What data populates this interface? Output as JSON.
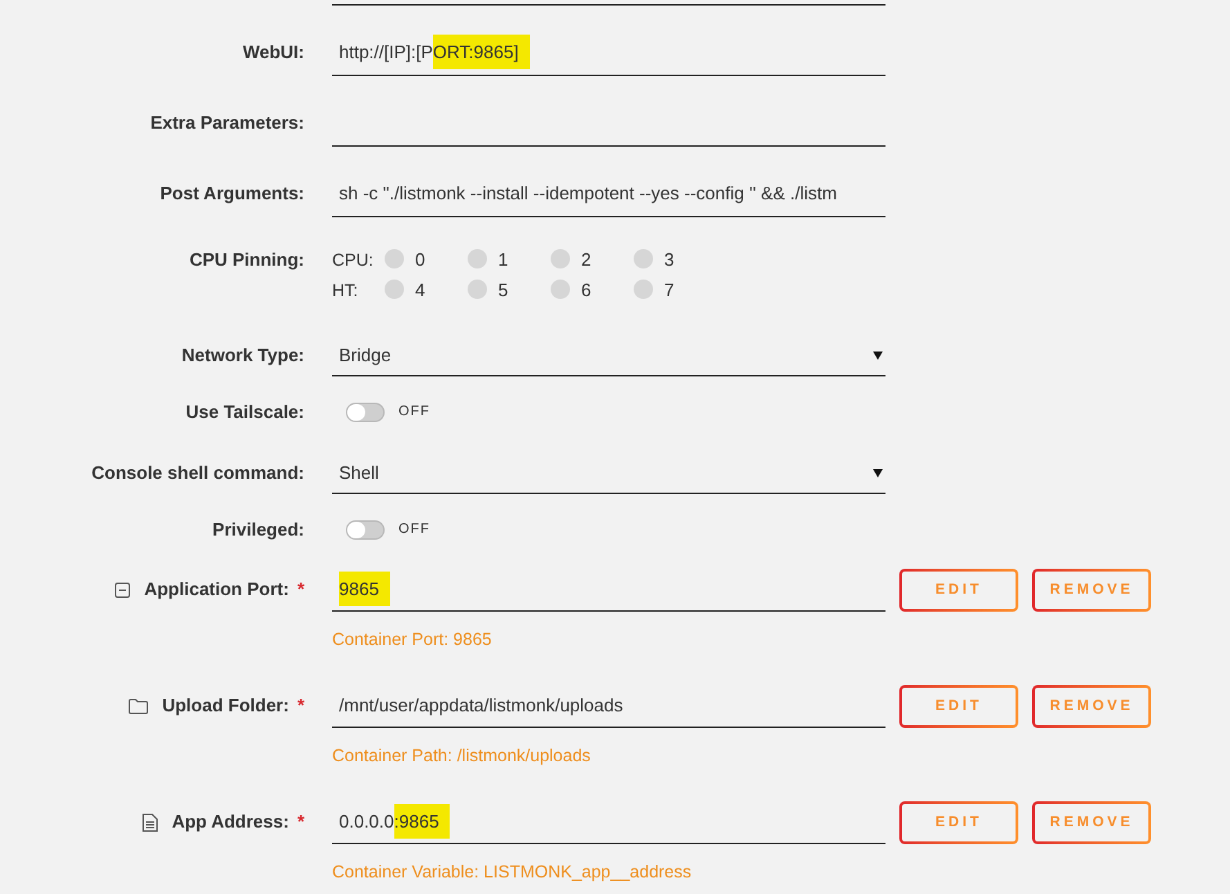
{
  "settings": [
    {
      "kind": "text",
      "label": "WebUI:",
      "value": [
        {
          "text": "http://[IP]:[P",
          "highlighted": false
        },
        {
          "text": "ORT:9865]",
          "highlighted": true
        }
      ]
    },
    {
      "kind": "text",
      "label": "Extra Parameters:"
    },
    {
      "kind": "text",
      "label": "Post Arguments:",
      "value": [
        {
          "text": "sh -c \"./listmonk --install --idempotent --yes --config '' && ./listm",
          "highlighted": false
        }
      ]
    },
    {
      "kind": "cpu_pinning",
      "label": "CPU Pinning:",
      "rows": [
        {
          "label": "CPU:",
          "cores": [
            {
              "number": "0",
              "checked": false
            },
            {
              "number": "1",
              "checked": false
            },
            {
              "number": "2",
              "checked": false
            },
            {
              "number": "3",
              "checked": false
            }
          ]
        },
        {
          "label": "HT:",
          "cores": [
            {
              "number": "4",
              "checked": false
            },
            {
              "number": "5",
              "checked": false
            },
            {
              "number": "6",
              "checked": false
            },
            {
              "number": "7",
              "checked": false
            }
          ]
        }
      ]
    },
    {
      "kind": "select",
      "label": "Network Type:",
      "value": "Bridge"
    },
    {
      "kind": "switch",
      "label": "Use Tailscale:",
      "on": false,
      "state_text": "OFF"
    },
    {
      "kind": "select",
      "label": "Console shell command:",
      "value": "Shell"
    },
    {
      "kind": "switch",
      "label": "Privileged:",
      "on": false,
      "state_text": "OFF"
    }
  ],
  "config_items": [
    {
      "kind": "port",
      "label": "Application Port:",
      "required_mark": "*",
      "value": [
        {
          "text": "9865",
          "highlighted": true
        }
      ],
      "description": "Container Port: 9865",
      "buttons": [
        "EDIT",
        "REMOVE"
      ]
    },
    {
      "kind": "path",
      "label": "Upload Folder:",
      "required_mark": "*",
      "value": [
        {
          "text": "/mnt/user/appdata/listmonk/uploads",
          "highlighted": false
        }
      ],
      "description": "Container Path: /listmonk/uploads",
      "buttons": [
        "EDIT",
        "REMOVE"
      ]
    },
    {
      "kind": "variable",
      "label": "App Address:",
      "required_mark": "*",
      "value": [
        {
          "text": "0.0.0.0",
          "highlighted": false
        },
        {
          "text": ":9865",
          "highlighted": true
        }
      ],
      "description": "Container Variable: LISTMONK_app__address",
      "buttons": [
        "EDIT",
        "REMOVE"
      ]
    }
  ]
}
